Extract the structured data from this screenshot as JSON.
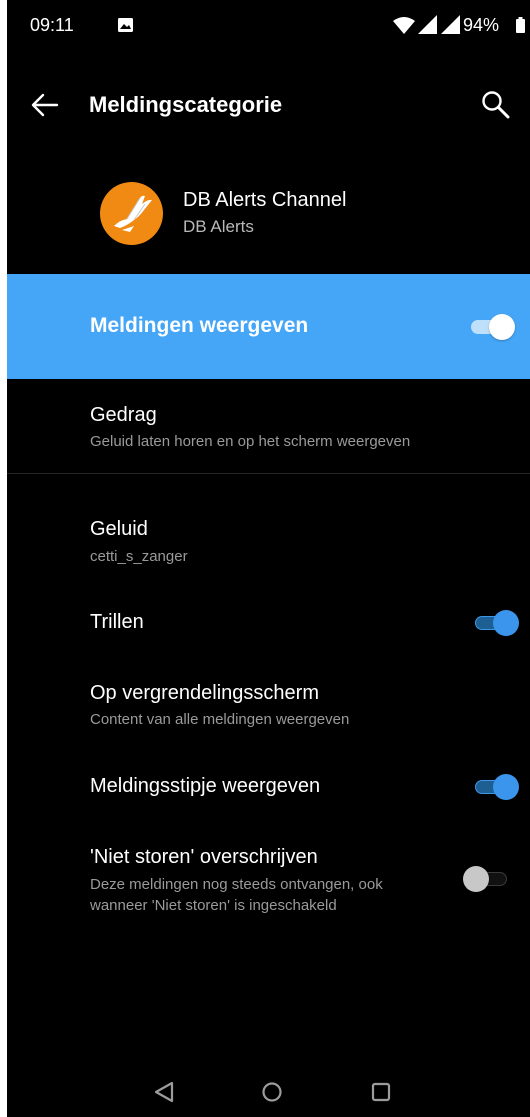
{
  "status_bar": {
    "time": "09:11",
    "battery_percent": "94%",
    "icons": [
      "photo-icon",
      "wifi-icon",
      "signal-icon",
      "signal-icon",
      "battery-icon"
    ]
  },
  "app_bar": {
    "title": "Meldingscategorie",
    "icons": [
      "back-arrow-icon",
      "search-icon"
    ]
  },
  "app_header": {
    "channel_name": "DB Alerts Channel",
    "app_name": "DB Alerts",
    "logo_icon": "bird-logo-icon"
  },
  "master_toggle": {
    "label": "Meldingen weergeven",
    "on": true
  },
  "settings": {
    "behavior": {
      "title": "Gedrag",
      "subtitle": "Geluid laten horen en op het scherm weergeven"
    },
    "sound": {
      "title": "Geluid",
      "subtitle": "cetti_s_zanger"
    },
    "vibrate": {
      "title": "Trillen",
      "on": true
    },
    "lockscreen": {
      "title": "Op vergrendelingsscherm",
      "subtitle": "Content van alle meldingen weergeven"
    },
    "badge": {
      "title": "Meldingsstipje weergeven",
      "on": true
    },
    "dnd_override": {
      "title": "'Niet storen' overschrijven",
      "subtitle_line1": "Deze meldingen nog steeds ontvangen, ook",
      "subtitle_line2": "wanneer 'Niet storen' is ingeschakeld",
      "on": false
    }
  },
  "nav_bar": {
    "icons": [
      "nav-back-icon",
      "nav-home-icon",
      "nav-recents-icon"
    ]
  },
  "colors": {
    "accent": "#3b95ec",
    "highlight_row": "#45a6f7",
    "app_logo": "#f08a12",
    "background": "#000000"
  }
}
